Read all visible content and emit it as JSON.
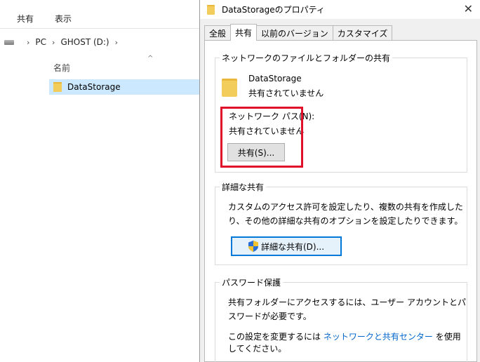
{
  "explorer": {
    "ribbon_tabs": [
      "共有",
      "表示"
    ],
    "path": [
      "PC",
      "GHOST (D:)"
    ],
    "column_header": "名前",
    "files": [
      "DataStorage"
    ]
  },
  "dialog": {
    "title": "DataStorageのプロパティ",
    "tabs": [
      "全般",
      "共有",
      "以前のバージョン",
      "カスタマイズ"
    ],
    "active_tab": "共有",
    "network_share": {
      "group_label": "ネットワークのファイルとフォルダーの共有",
      "folder_name": "DataStorage",
      "folder_status": "共有されていません",
      "network_path_label": "ネットワーク パス(N):",
      "network_path_value": "共有されていません",
      "share_button": "共有(S)..."
    },
    "advanced_sharing": {
      "group_label": "詳細な共有",
      "description": "カスタムのアクセス許可を設定したり、複数の共有を作成したり、その他の詳細な共有のオプションを設定したりできます。",
      "button": "詳細な共有(D)..."
    },
    "password_protection": {
      "group_label": "パスワード保護",
      "description": "共有フォルダーにアクセスするには、ユーザー アカウントとパスワードが必要です。",
      "change_prefix": "この設定を変更するには",
      "link": "ネットワークと共有センター",
      "change_suffix": "を使用してください。"
    }
  },
  "colors": {
    "highlight": "#e0102a",
    "selection": "#cce8ff",
    "link": "#0066cc",
    "folder": "#f3cd5b"
  }
}
